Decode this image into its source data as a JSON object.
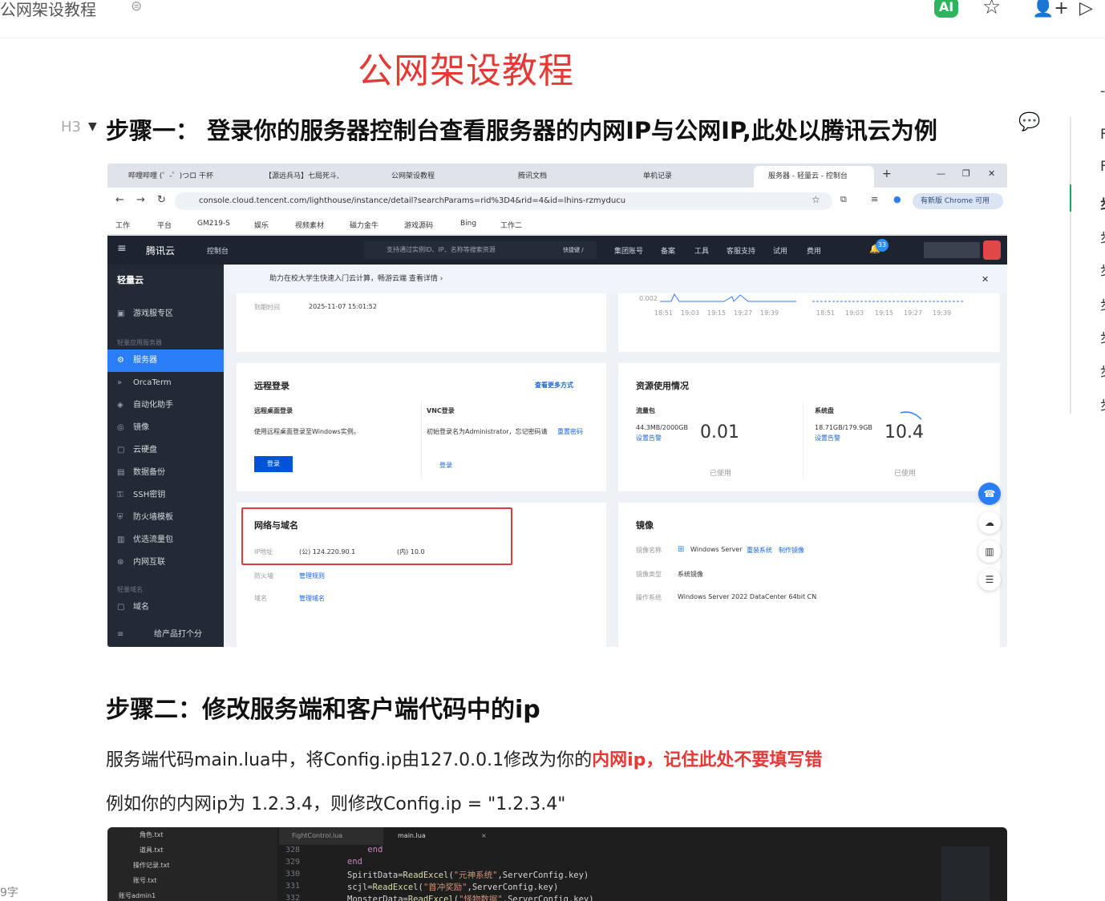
{
  "topbar": {
    "doc_title": "公网架设教程",
    "ai_label": "AI"
  },
  "big_title": "公网架设教程",
  "h3_tag": "H3",
  "step1": "步骤一： 登录你的服务器控制台查看服务器的内网IP与公网IP,此处以腾讯云为例",
  "right_chars": [
    "-",
    "F",
    "F",
    "步",
    "步",
    "步",
    "步",
    "步",
    "步",
    "步"
  ],
  "browser": {
    "tabs": [
      "哔哩哔哩 (゜-゜)つロ 干杯",
      "【源远兵马】七局死斗,",
      "公网架设教程",
      "腾讯文档",
      "单机记录",
      "服务器 - 轻量云 - 控制台"
    ],
    "url": "console.cloud.tencent.com/lighthouse/instance/detail?searchParams=rid%3D4&rid=4&id=lhins-rzmyducu",
    "chip": "有新版 Chrome 可用",
    "bookmarks": [
      "工作",
      "平台",
      "GM219-S",
      "娱乐",
      "视频素材",
      "磁力金牛",
      "游戏源码",
      "Bing",
      "工作二"
    ]
  },
  "console": {
    "logo": "腾讯云",
    "home": "控制台",
    "search": "支持通过实例ID、IP、名称等搜索资源",
    "shortcut": "快捷键 /",
    "nav": [
      "集团账号",
      "备案",
      "工具",
      "客服支持",
      "试用",
      "费用"
    ],
    "badge": "33",
    "side_title": "轻量云",
    "side": [
      "游戏服专区",
      "服务器",
      "OrcaTerm",
      "自动化助手",
      "镜像",
      "云硬盘",
      "数据备份",
      "SSH密钥",
      "防火墙模板",
      "优选流量包",
      "内网互联",
      "域名"
    ],
    "side_groups": [
      "轻量应用服务器",
      "轻量域名"
    ],
    "side_footer": "给产品打个分",
    "banner": "助力在校大学生快速入门云计算，畅游云端  查看详情 ›",
    "expire_label": "到期时间",
    "expire": "2025-11-07 15:01:52",
    "chart_y": "0.002",
    "chart_ticks": [
      "18:51",
      "19:03",
      "19:15",
      "19:27",
      "19:39"
    ],
    "remote": {
      "title": "远程登录",
      "more": "查看更多方式",
      "rd_title": "远程桌面登录",
      "rd_desc": "使用远程桌面登录至Windows实例。",
      "login": "登录",
      "vnc_title": "VNC登录",
      "vnc_desc": "初始登录名为Administrator，忘记密码请",
      "reset": "重置密码",
      "vnc_login": "登录"
    },
    "res": {
      "title": "资源使用情况",
      "traffic": "流量包",
      "traffic_val": "44.3MB/2000GB",
      "alert": "设置告警",
      "traffic_pct": "0.01",
      "disk": "系统盘",
      "disk_val": "18.71GB/179.9GB",
      "disk_pct": "10.4",
      "used": "已使用"
    },
    "net": {
      "title": "网络与域名",
      "ip_label": "IP地址",
      "pub": "(公) 124.220.90.1",
      "priv": "(内) 10.0",
      "fw_label": "防火墙",
      "fw": "管理规则",
      "dom_label": "域名",
      "dom": "管理域名"
    },
    "img": {
      "title": "镜像",
      "name_label": "镜像名称",
      "name": "Windows Server",
      "rebuild": "重装系统",
      "make": "制作镜像",
      "type_label": "镜像类型",
      "type": "系统镜像",
      "os_label": "操作系统",
      "os": "Windows Server 2022 DataCenter 64bit CN"
    }
  },
  "step2": "步骤二：修改服务端和客户端代码中的ip",
  "para1": {
    "pre": "服务端代码main.lua中，将Config.ip由127.0.0.1修改为你的",
    "red": "内网ip，记住此处不要填写错"
  },
  "para2": "例如你的内网ip为 1.2.3.4，则修改Config.ip = \"1.2.3.4\"",
  "code": {
    "files": [
      "角色.txt",
      "道具.txt",
      "操作记录.txt",
      "账号.txt",
      "账号admin1"
    ],
    "tabs": [
      "FightControl.lua",
      "main.lua"
    ],
    "lines": [
      "328",
      "329",
      "330",
      "331",
      "332"
    ]
  },
  "word_count": "9字",
  "colors": {
    "accent": "#e53935",
    "green": "#20a55a",
    "blue": "#2c7ef8"
  }
}
